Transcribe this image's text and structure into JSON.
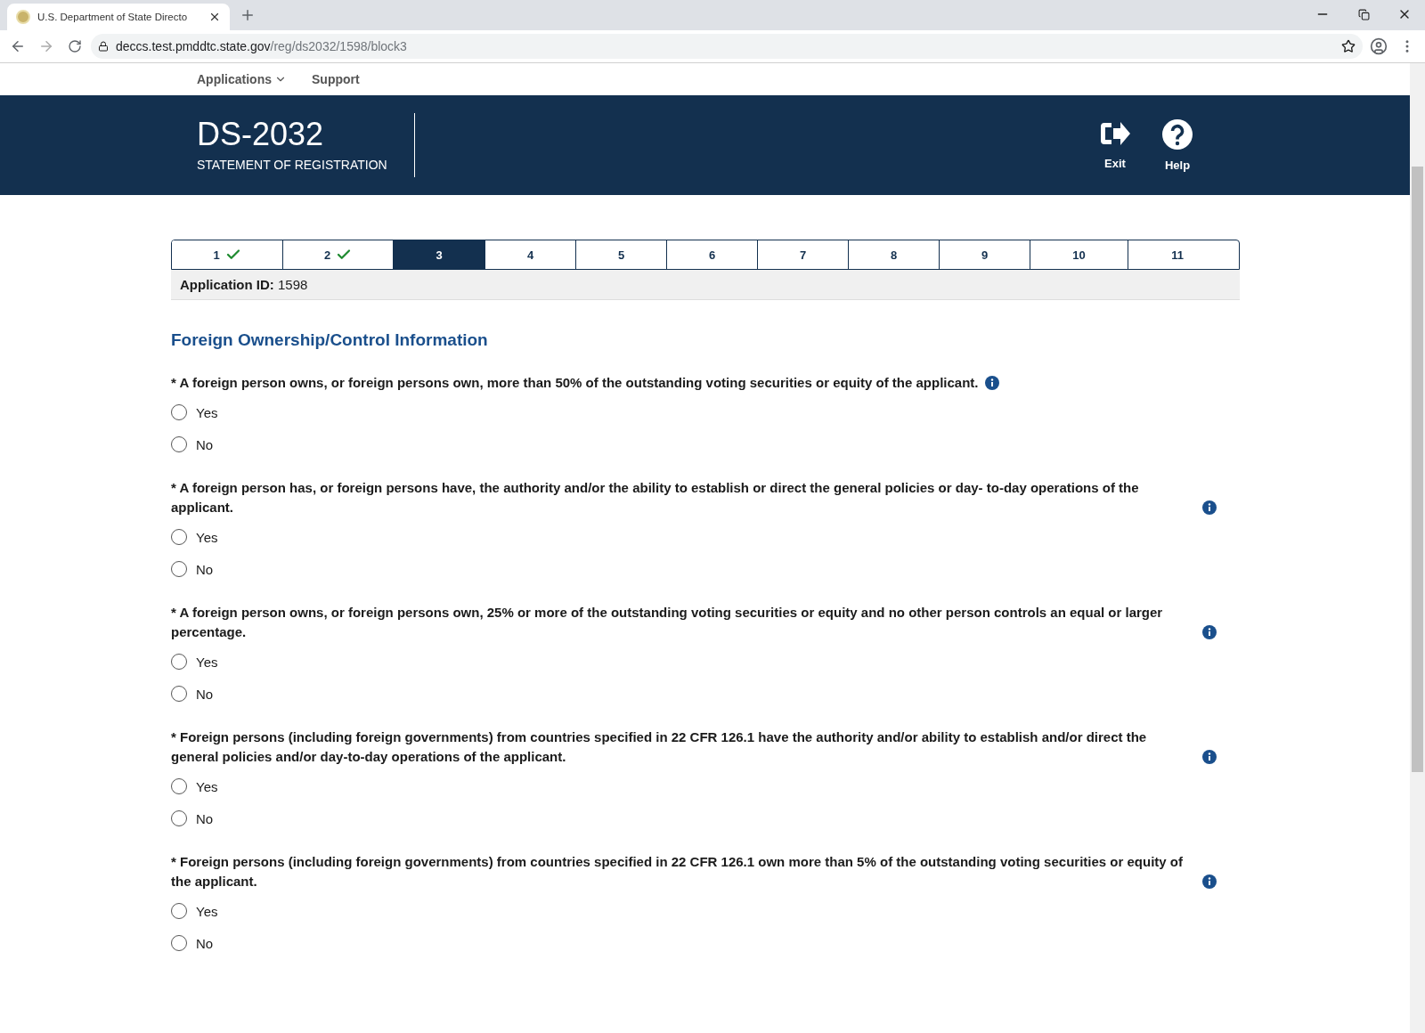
{
  "browser": {
    "tab_title": "U.S. Department of State Directo",
    "url_host": "deccs.test.pmddtc.state.gov",
    "url_path": "/reg/ds2032/1598/block3"
  },
  "nav": [
    {
      "label": "Applications",
      "dropdown": true
    },
    {
      "label": "Support",
      "dropdown": false
    }
  ],
  "header": {
    "title": "DS-2032",
    "subtitle": "STATEMENT OF REGISTRATION",
    "actions": [
      {
        "kind": "exit",
        "label": "Exit"
      },
      {
        "kind": "help",
        "label": "Help"
      }
    ]
  },
  "steps": [
    {
      "label": "1",
      "completed": true,
      "selected": false
    },
    {
      "label": "2",
      "completed": true,
      "selected": false
    },
    {
      "label": "3",
      "completed": false,
      "selected": true
    },
    {
      "label": "4",
      "completed": false,
      "selected": false
    },
    {
      "label": "5",
      "completed": false,
      "selected": false
    },
    {
      "label": "6",
      "completed": false,
      "selected": false
    },
    {
      "label": "7",
      "completed": false,
      "selected": false
    },
    {
      "label": "8",
      "completed": false,
      "selected": false
    },
    {
      "label": "9",
      "completed": false,
      "selected": false
    },
    {
      "label": "10",
      "completed": false,
      "selected": false
    },
    {
      "label": "11",
      "completed": false,
      "selected": false
    }
  ],
  "application_id": {
    "label": "Application ID:",
    "value": "1598"
  },
  "section_title": "Foreign Ownership/Control Information",
  "questions": [
    {
      "text": "* A foreign person owns, or foreign persons own, more than 50% of the outstanding voting securities or equity of the applicant.",
      "options": [
        {
          "label": "Yes",
          "selected": false
        },
        {
          "label": "No",
          "selected": false
        }
      ]
    },
    {
      "text": "* A foreign person has, or foreign persons have, the authority and/or the ability to establish or direct the general policies or day- to-day operations of the applicant.",
      "options": [
        {
          "label": "Yes",
          "selected": false
        },
        {
          "label": "No",
          "selected": false
        }
      ]
    },
    {
      "text": "* A foreign person owns, or foreign persons own, 25% or more of the outstanding voting securities or equity and no other person controls an equal or larger percentage.",
      "options": [
        {
          "label": "Yes",
          "selected": false
        },
        {
          "label": "No",
          "selected": false
        }
      ]
    },
    {
      "text": "* Foreign persons (including foreign governments) from countries specified in 22 CFR 126.1 have the authority and/or ability to establish and/or direct the general policies and/or day-to-day operations of the applicant.",
      "options": [
        {
          "label": "Yes",
          "selected": false
        },
        {
          "label": "No",
          "selected": false
        }
      ]
    },
    {
      "text": "* Foreign persons (including foreign governments) from countries specified in 22 CFR 126.1 own more than 5% of the outstanding voting securities or equity of the applicant.",
      "options": [
        {
          "label": "Yes",
          "selected": false
        },
        {
          "label": "No",
          "selected": false
        }
      ]
    }
  ]
}
